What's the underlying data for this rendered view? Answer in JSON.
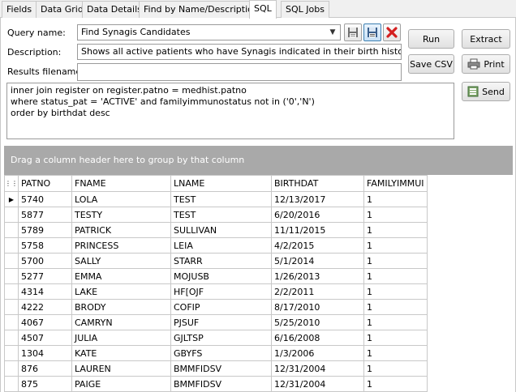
{
  "tabs": [
    {
      "label": "Fields",
      "active": false
    },
    {
      "label": "Data Grid",
      "active": false
    },
    {
      "label": "Data Details",
      "active": false
    },
    {
      "label": "Find by Name/Description",
      "active": false
    },
    {
      "label": "SQL",
      "active": true
    },
    {
      "label": "SQL Jobs",
      "active": false
    }
  ],
  "form": {
    "query_name_label": "Query name:",
    "query_name_value": "Find Synagis Candidates",
    "description_label": "Description:",
    "description_value": "Shows all active patients who have Synagis indicated in their birth history",
    "results_filename_label": "Results filename:",
    "results_filename_value": ""
  },
  "buttons": {
    "run": "Run",
    "extract": "Extract",
    "save_csv": "Save CSV",
    "print": "Print",
    "send": "Send"
  },
  "sql_text": "inner join register on register.patno = medhist.patno\nwhere status_pat = 'ACTIVE' and familyimmunostatus not in ('0','N')\norder by birthdat desc",
  "group_hint": "Drag a column header here to group by that column",
  "grid": {
    "columns": [
      "PATNO",
      "FNAME",
      "LNAME",
      "BIRTHDAT",
      "FAMILYIMMUI"
    ],
    "rows": [
      [
        "5740",
        "LOLA",
        "TEST",
        "12/13/2017",
        "1"
      ],
      [
        "5877",
        "TESTY",
        "TEST",
        "6/20/2016",
        "1"
      ],
      [
        "5789",
        "PATRICK",
        "SULLIVAN",
        "11/11/2015",
        "1"
      ],
      [
        "5758",
        "PRINCESS",
        "LEIA",
        "4/2/2015",
        "1"
      ],
      [
        "5700",
        "SALLY",
        "STARR",
        "5/1/2014",
        "1"
      ],
      [
        "5277",
        "EMMA",
        "MOJUSB",
        "1/26/2013",
        "1"
      ],
      [
        "4314",
        "LAKE",
        "HF[OJF",
        "2/2/2011",
        "1"
      ],
      [
        "4222",
        "BRODY",
        "COFIP",
        "8/17/2010",
        "1"
      ],
      [
        "4067",
        "CAMRYN",
        "PJSUF",
        "5/25/2010",
        "1"
      ],
      [
        "4507",
        "JULIA",
        "GJLTSP",
        "6/16/2008",
        "1"
      ],
      [
        "1304",
        "KATE",
        "GBYFS",
        "1/3/2006",
        "1"
      ],
      [
        "876",
        "LAUREN",
        "BMMFIDSV",
        "12/31/2004",
        "1"
      ],
      [
        "875",
        "PAIGE",
        "BMMFIDSV",
        "12/31/2004",
        "1"
      ]
    ]
  },
  "icons": {
    "save_query": "save-icon",
    "save_as_query": "save-as-icon",
    "delete_query": "delete-x-icon",
    "print": "printer-icon",
    "send": "send-icon",
    "current_row": "row-pointer-icon",
    "column_chooser": "column-chooser-icon"
  },
  "colors": {
    "group_area": "#a9a9a9",
    "delete_red": "#d42020",
    "selected_btn": "#c9e1f6"
  }
}
